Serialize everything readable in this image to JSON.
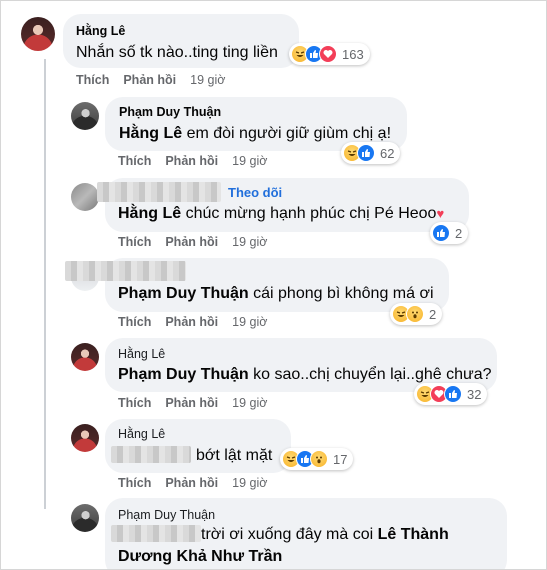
{
  "comments": [
    {
      "author": "Hằng Lê",
      "text": "Nhắn số tk nào..ting ting liền",
      "reactions": [
        "haha",
        "like",
        "love"
      ],
      "count": "163",
      "actions": {
        "like": "Thích",
        "reply": "Phản hồi",
        "time": "19 giờ"
      }
    },
    {
      "author": "Phạm Duy Thuận",
      "mention": "Hằng Lê",
      "text": " em đòi người giữ giùm chị ạ!",
      "reactions": [
        "haha",
        "like"
      ],
      "count": "62",
      "actions": {
        "like": "Thích",
        "reply": "Phản hồi",
        "time": "19 giờ"
      }
    },
    {
      "follow": "Theo dõi",
      "mention": "Hằng Lê",
      "text": " chúc mừng hạnh phúc chị Pé Heoo",
      "reactions": [
        "like"
      ],
      "count": "2",
      "actions": {
        "like": "Thích",
        "reply": "Phản hồi",
        "time": "19 giờ"
      }
    },
    {
      "mention": "Phạm Duy Thuận",
      "text": " cái phong bì không má ơi",
      "reactions": [
        "haha",
        "wow"
      ],
      "count": "2",
      "actions": {
        "like": "Thích",
        "reply": "Phản hồi",
        "time": "19 giờ"
      }
    },
    {
      "author": "Hằng Lê",
      "mention": "Phạm Duy Thuận",
      "text": " ko sao..chị chuyển lại..ghê chưa?",
      "reactions": [
        "haha",
        "love",
        "like"
      ],
      "count": "32",
      "actions": {
        "like": "Thích",
        "reply": "Phản hồi",
        "time": "19 giờ"
      }
    },
    {
      "author": "Hằng Lê",
      "text": "bớt lật mặt",
      "reactions": [
        "haha",
        "like",
        "wow"
      ],
      "count": "17",
      "actions": {
        "like": "Thích",
        "reply": "Phản hồi",
        "time": "19 giờ"
      }
    },
    {
      "author": "Phạm Duy Thuận",
      "text": " trời ơi xuống đây mà coi ",
      "mention": "Lê Thành",
      "mention2": "Dương Khả Như Trần"
    }
  ],
  "colors": {
    "bubble": "#f0f2f5",
    "link": "#216fdb",
    "meta": "#65676b",
    "like": "#1877f2",
    "love": "#f33e58",
    "haha": "#f7b125"
  }
}
